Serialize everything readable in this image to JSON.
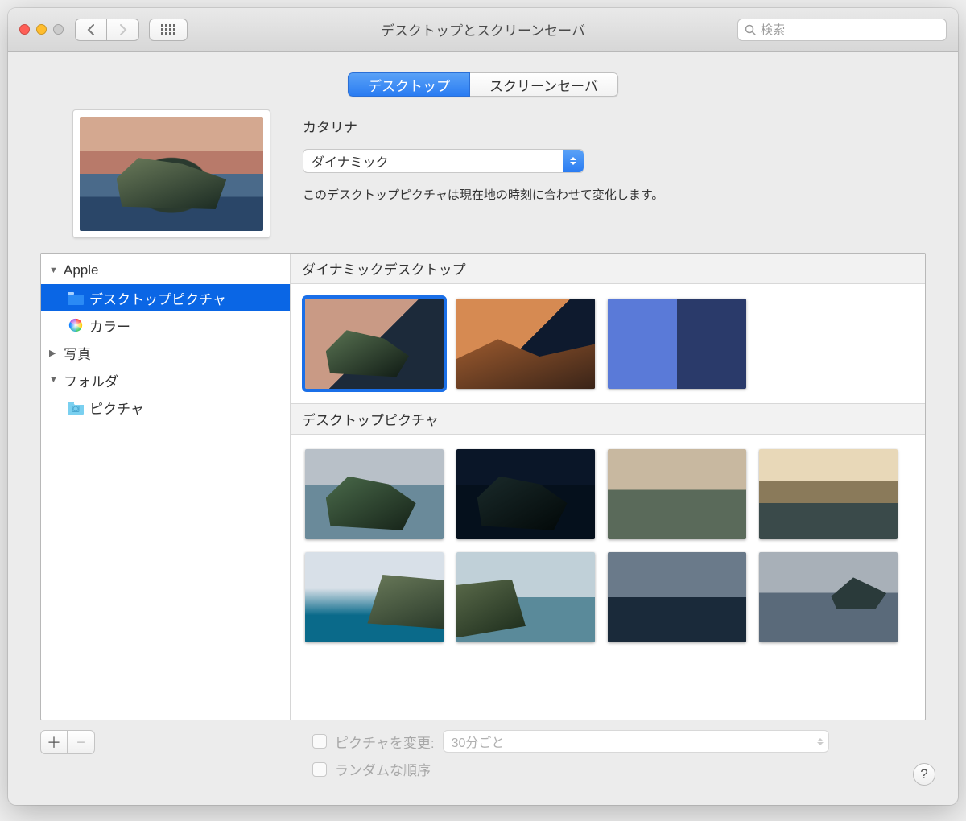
{
  "window_title": "デスクトップとスクリーンセーバ",
  "search_placeholder": "検索",
  "tabs": {
    "desktop": "デスクトップ",
    "screensaver": "スクリーンセーバ"
  },
  "current": {
    "name": "カタリナ",
    "mode": "ダイナミック",
    "description": "このデスクトップピクチャは現在地の時刻に合わせて変化します。"
  },
  "sidebar": {
    "apple": "Apple",
    "desktop_pictures": "デスクトップピクチャ",
    "colors": "カラー",
    "photos": "写真",
    "folders": "フォルダ",
    "pictures": "ピクチャ"
  },
  "sections": {
    "dynamic": "ダイナミックデスクトップ",
    "pictures": "デスクトップピクチャ"
  },
  "bottom": {
    "change_picture": "ピクチャを変更:",
    "interval": "30分ごと",
    "random": "ランダムな順序"
  },
  "help": "?"
}
